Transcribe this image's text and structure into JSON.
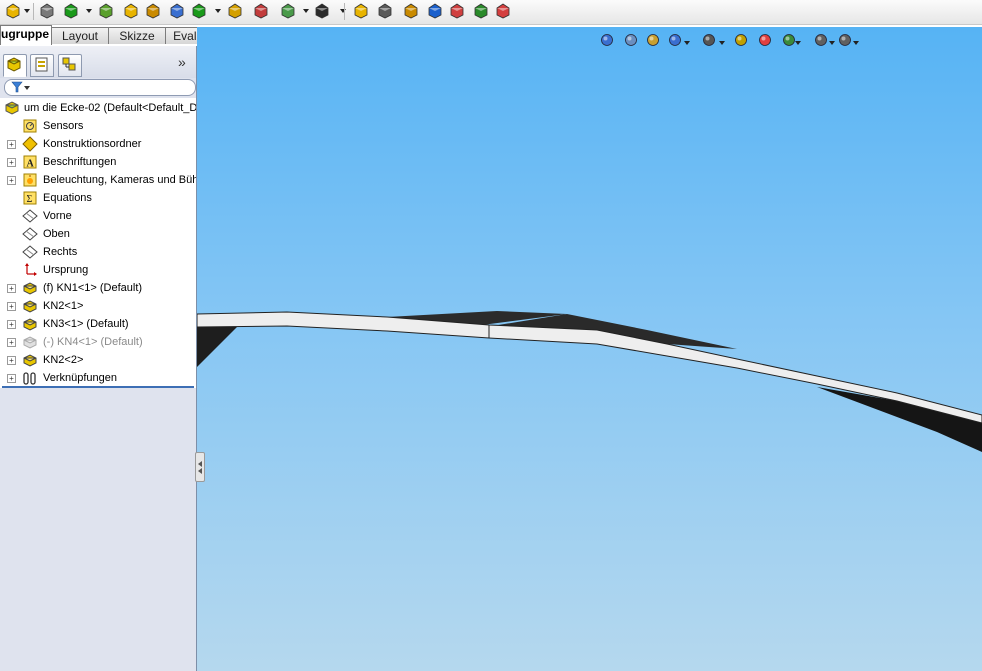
{
  "toolbar": {
    "icons": [
      "insert-component-icon",
      "mate-icon",
      "linear-pattern-icon",
      "smart-fasteners-icon",
      "move-component-icon",
      "show-hidden-icon",
      "assembly-features-icon",
      "reference-geometry-icon",
      "new-motion-study-icon",
      "bill-of-materials-icon",
      "exploded-view-icon",
      "explode-line-icon",
      "interference-detection-icon",
      "clearance-icon",
      "hole-alignment-icon",
      "measure-icon",
      "mass-properties-icon",
      "instant3d-icon",
      "large-assembly-icon"
    ]
  },
  "command_tabs": {
    "items": [
      {
        "label": "ugruppe",
        "active": true
      },
      {
        "label": "Layout",
        "active": false
      },
      {
        "label": "Skizze",
        "active": false
      },
      {
        "label": "Evaluieren",
        "active": false
      }
    ]
  },
  "feature_manager": {
    "tabs": [
      "featuremanager-tree-icon",
      "propertymanager-icon",
      "configurationmanager-icon"
    ],
    "expand_glyph": "»",
    "filter_icon": "filter-icon",
    "root": {
      "label": "um die Ecke-02  (Default<Default_D",
      "icon": "assembly-icon"
    },
    "items": [
      {
        "label": "Sensors",
        "icon": "sensor-icon",
        "expandable": false,
        "suppressed": false
      },
      {
        "label": "Konstruktionsordner",
        "icon": "design-binder-icon",
        "expandable": true,
        "suppressed": false
      },
      {
        "label": "Beschriftungen",
        "icon": "annotations-icon",
        "expandable": true,
        "suppressed": false
      },
      {
        "label": "Beleuchtung, Kameras und Bühr",
        "icon": "lights-cameras-icon",
        "expandable": true,
        "suppressed": false
      },
      {
        "label": "Equations",
        "icon": "equations-icon",
        "expandable": false,
        "suppressed": false
      },
      {
        "label": "Vorne",
        "icon": "plane-icon",
        "expandable": false,
        "suppressed": false
      },
      {
        "label": "Oben",
        "icon": "plane-icon",
        "expandable": false,
        "suppressed": false
      },
      {
        "label": "Rechts",
        "icon": "plane-icon",
        "expandable": false,
        "suppressed": false
      },
      {
        "label": "Ursprung",
        "icon": "origin-icon",
        "expandable": false,
        "suppressed": false
      },
      {
        "label": "(f) KN1<1> (Default)",
        "icon": "part-icon",
        "expandable": true,
        "suppressed": false
      },
      {
        "label": "KN2<1>",
        "icon": "part-icon",
        "expandable": true,
        "suppressed": false
      },
      {
        "label": "KN3<1> (Default)",
        "icon": "part-icon",
        "expandable": true,
        "suppressed": false
      },
      {
        "label": "(-) KN4<1> (Default)",
        "icon": "part-icon",
        "expandable": true,
        "suppressed": true
      },
      {
        "label": "KN2<2>",
        "icon": "part-icon",
        "expandable": true,
        "suppressed": false
      },
      {
        "label": "Verknüpfungen",
        "icon": "mates-icon",
        "expandable": true,
        "suppressed": false
      }
    ]
  },
  "view_toolbar": {
    "icons": [
      "zoom-to-fit-icon",
      "zoom-to-area-icon",
      "previous-view-icon",
      "section-view-icon",
      "view-orientation-icon",
      "display-style-icon",
      "hide-show-items-icon",
      "edit-appearance-icon",
      "apply-scene-icon",
      "view-settings-icon"
    ]
  },
  "colors": {
    "viewport_top": "#56b3f4",
    "viewport_bottom": "#b5d8ee",
    "panel_bg": "#dfe3ee",
    "selection_line": "#3d6fb5"
  }
}
